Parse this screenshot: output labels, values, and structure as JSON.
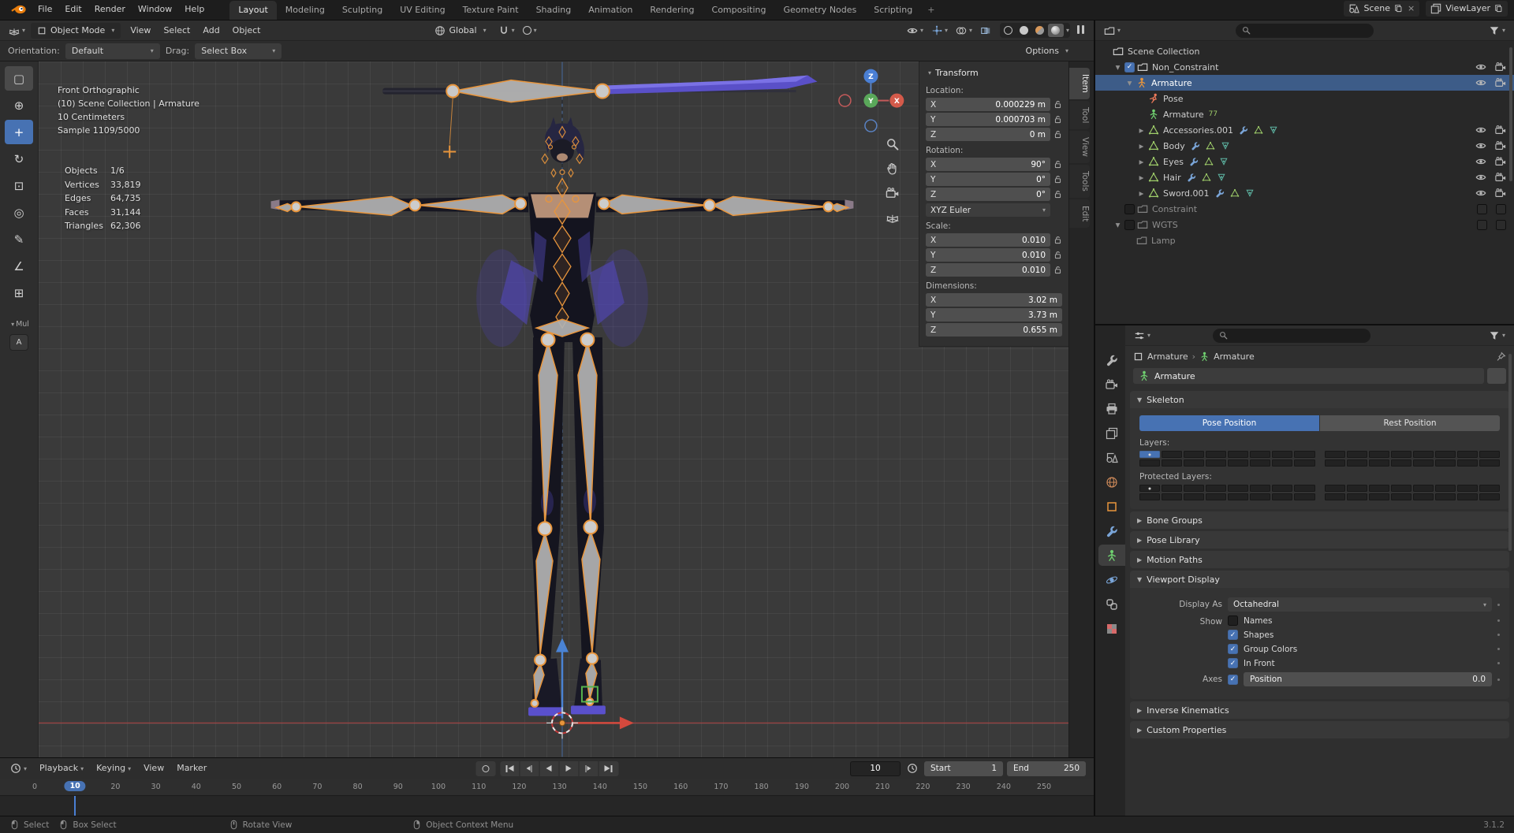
{
  "topbar": {
    "menus": [
      "File",
      "Edit",
      "Render",
      "Window",
      "Help"
    ],
    "workspaces": [
      "Layout",
      "Modeling",
      "Sculpting",
      "UV Editing",
      "Texture Paint",
      "Shading",
      "Animation",
      "Rendering",
      "Compositing",
      "Geometry Nodes",
      "Scripting"
    ],
    "active_workspace": "Layout",
    "add_workspace_label": "+",
    "scene_label": "Scene",
    "viewlayer_label": "ViewLayer"
  },
  "viewport_header": {
    "mode": "Object Mode",
    "menus": [
      "View",
      "Select",
      "Add",
      "Object"
    ],
    "orientation": "Global"
  },
  "tool_settings": {
    "orientation_label": "Orientation:",
    "orientation_value": "Default",
    "drag_label": "Drag:",
    "drag_value": "Select Box",
    "options_label": "Options"
  },
  "toolbar": {
    "tools": [
      {
        "name": "select-box",
        "glyph": "▢",
        "state": "pressed"
      },
      {
        "name": "cursor",
        "glyph": "⊕",
        "state": ""
      },
      {
        "name": "move",
        "glyph": "+",
        "state": "active"
      },
      {
        "name": "rotate",
        "glyph": "↻",
        "state": ""
      },
      {
        "name": "scale",
        "glyph": "⊡",
        "state": ""
      },
      {
        "name": "transform",
        "glyph": "◎",
        "state": ""
      },
      {
        "name": "annotate",
        "glyph": "✎",
        "state": ""
      },
      {
        "name": "measure",
        "glyph": "∠",
        "state": ""
      },
      {
        "name": "add-cube",
        "glyph": "⊞",
        "state": ""
      }
    ],
    "extra_label": "Mul",
    "extra2_label": "A"
  },
  "viewport": {
    "info_lines": [
      "Front Orthographic",
      "(10) Scene Collection | Armature",
      "10 Centimeters",
      "Sample 1109/5000"
    ],
    "stats": [
      {
        "label": "Objects",
        "value": "1/6"
      },
      {
        "label": "Vertices",
        "value": "33,819"
      },
      {
        "label": "Edges",
        "value": "64,735"
      },
      {
        "label": "Faces",
        "value": "31,144"
      },
      {
        "label": "Triangles",
        "value": "62,306"
      }
    ],
    "gizmo_axes": {
      "z": "Z",
      "y": "Y",
      "x": "X"
    }
  },
  "sidebar": {
    "tabs": [
      "Item",
      "Tool",
      "View",
      "Tools",
      "Edit"
    ],
    "active_tab": "Item"
  },
  "transform_panel": {
    "title": "Transform",
    "sections": [
      {
        "label": "Location:",
        "locks": true,
        "rows": [
          {
            "axis": "X",
            "value": "0.000229 m"
          },
          {
            "axis": "Y",
            "value": "0.000703 m"
          },
          {
            "axis": "Z",
            "value": "0 m"
          }
        ]
      },
      {
        "label": "Rotation:",
        "locks": true,
        "dropdown": "XYZ Euler",
        "rows": [
          {
            "axis": "X",
            "value": "90°"
          },
          {
            "axis": "Y",
            "value": "0°"
          },
          {
            "axis": "Z",
            "value": "0°"
          }
        ]
      },
      {
        "label": "Scale:",
        "locks": true,
        "rows": [
          {
            "axis": "X",
            "value": "0.010"
          },
          {
            "axis": "Y",
            "value": "0.010"
          },
          {
            "axis": "Z",
            "value": "0.010"
          }
        ]
      },
      {
        "label": "Dimensions:",
        "locks": false,
        "rows": [
          {
            "axis": "X",
            "value": "3.02 m"
          },
          {
            "axis": "Y",
            "value": "3.73 m"
          },
          {
            "axis": "Z",
            "value": "0.655 m"
          }
        ]
      }
    ]
  },
  "outliner": {
    "rows": [
      {
        "indent": 0,
        "arrow": "",
        "icon": "collection",
        "label": "Scene Collection",
        "right": []
      },
      {
        "indent": 1,
        "arrow": "down",
        "checkbox": "checked",
        "icon": "collection",
        "label": "Non_Constraint",
        "right": [
          "eye",
          "camera"
        ]
      },
      {
        "indent": 2,
        "arrow": "down",
        "icon": "armature-object",
        "label": "Armature",
        "selected": true,
        "right": [
          "eye",
          "camera"
        ]
      },
      {
        "indent": 3,
        "arrow": "",
        "icon": "pose",
        "label": "Pose",
        "right": []
      },
      {
        "indent": 3,
        "arrow": "",
        "icon": "armature-data",
        "label": "Armature",
        "badge": "77",
        "right": []
      },
      {
        "indent": 3,
        "arrow": "right",
        "icon": "mesh",
        "label": "Accessories.001",
        "mods": [
          "wrench",
          "meshdata",
          "vgroup"
        ],
        "right": [
          "eye",
          "camera"
        ]
      },
      {
        "indent": 3,
        "arrow": "right",
        "icon": "mesh",
        "label": "Body",
        "mods": [
          "wrench",
          "meshdata",
          "vgroup"
        ],
        "right": [
          "eye",
          "camera"
        ]
      },
      {
        "indent": 3,
        "arrow": "right",
        "icon": "mesh",
        "label": "Eyes",
        "mods": [
          "wrench",
          "meshdata",
          "vgroup"
        ],
        "right": [
          "eye",
          "camera"
        ]
      },
      {
        "indent": 3,
        "arrow": "right",
        "icon": "mesh",
        "label": "Hair",
        "mods": [
          "wrench",
          "meshdata",
          "vgroup"
        ],
        "right": [
          "eye",
          "camera"
        ]
      },
      {
        "indent": 3,
        "arrow": "right",
        "icon": "mesh",
        "label": "Sword.001",
        "mods": [
          "wrench",
          "meshdata",
          "vgroup"
        ],
        "right": [
          "eye",
          "camera"
        ]
      },
      {
        "indent": 1,
        "arrow": "",
        "checkbox": "unchecked",
        "icon": "collection",
        "label": "Constraint",
        "dim": true,
        "right": [
          "box",
          "box"
        ]
      },
      {
        "indent": 1,
        "arrow": "down",
        "checkbox": "unchecked",
        "icon": "collection",
        "label": "WGTS",
        "dim": true,
        "right": [
          "box",
          "box"
        ]
      },
      {
        "indent": 2,
        "arrow": "",
        "icon": "collection",
        "label": "Lamp",
        "dim": true,
        "right": []
      }
    ]
  },
  "properties": {
    "tabs": [
      {
        "name": "tool"
      },
      {
        "name": "render"
      },
      {
        "name": "output"
      },
      {
        "name": "view-layer"
      },
      {
        "name": "scene"
      },
      {
        "name": "world"
      },
      {
        "name": "object"
      },
      {
        "name": "modifier"
      },
      {
        "name": "data",
        "active": true
      },
      {
        "name": "physics"
      },
      {
        "name": "constraint"
      },
      {
        "name": "texture"
      }
    ],
    "breadcrumb": {
      "object": "Armature",
      "data": "Armature"
    },
    "name_field": "Armature",
    "skeleton": {
      "title": "Skeleton",
      "pose_position": "Pose Position",
      "rest_position": "Rest Position",
      "layers_label": "Layers:",
      "protected_label": "Protected Layers:",
      "layers": {
        "active": [
          0
        ],
        "dots": [
          0
        ]
      },
      "protected": {
        "active": [],
        "dots": [
          0
        ]
      }
    },
    "collapsed_mid": [
      "Bone Groups",
      "Pose Library",
      "Motion Paths"
    ],
    "viewport_display": {
      "title": "Viewport Display",
      "display_as_label": "Display As",
      "display_as_value": "Octahedral",
      "show_label": "Show",
      "toggles": [
        {
          "label": "Names",
          "checked": false
        },
        {
          "label": "Shapes",
          "checked": true
        },
        {
          "label": "Group Colors",
          "checked": true
        },
        {
          "label": "In Front",
          "checked": true
        }
      ],
      "axes_label": "Axes",
      "axes_checked": true,
      "position_label": "Position",
      "position_value": "0.0"
    },
    "collapsed_end": [
      "Inverse Kinematics",
      "Custom Properties"
    ]
  },
  "timeline": {
    "menus": [
      "Playback",
      "Keying",
      "View",
      "Marker"
    ],
    "transport": [
      "auto-key",
      "jump-start",
      "prev-keyframe",
      "play-reverse",
      "play",
      "next-keyframe",
      "jump-end"
    ],
    "current_frame": "10",
    "start_label": "Start",
    "start_value": "1",
    "end_label": "End",
    "end_value": "250",
    "ticks": [
      0,
      10,
      20,
      30,
      40,
      50,
      60,
      70,
      80,
      90,
      100,
      110,
      120,
      130,
      140,
      150,
      160,
      170,
      180,
      190,
      200,
      210,
      220,
      230,
      240,
      250
    ],
    "playhead_frame": 10
  },
  "statusbar": {
    "hints": [
      {
        "icon": "mouse-left",
        "label": "Select"
      },
      {
        "icon": "mouse-left-drag",
        "label": "Box Select"
      },
      {
        "icon": "mouse-middle",
        "label": "Rotate View"
      },
      {
        "icon": "mouse-right",
        "label": "Object Context Menu"
      }
    ],
    "version": "3.1.2"
  }
}
